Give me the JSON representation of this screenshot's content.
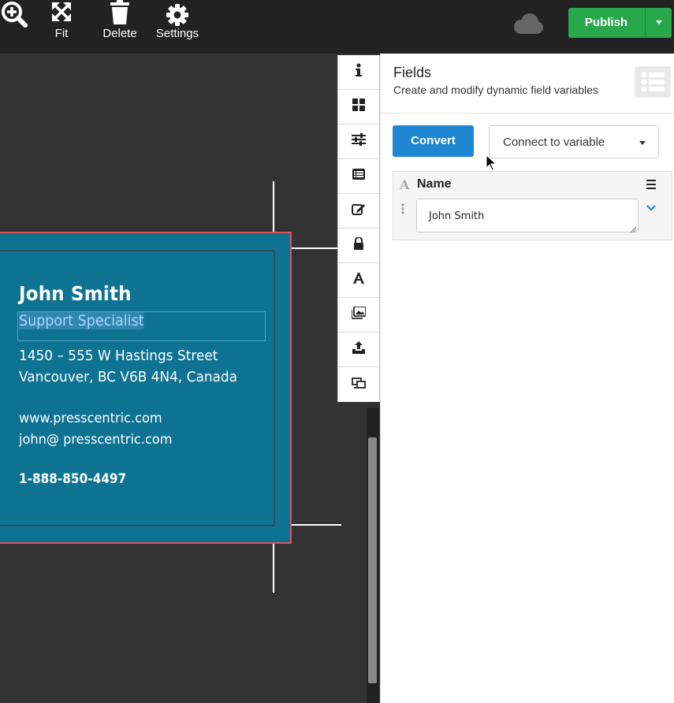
{
  "toolbar": {
    "zoom_icon": "zoom-in-icon",
    "fit_label": "Fit",
    "delete_label": "Delete",
    "settings_label": "Settings",
    "publish_label": "Publish"
  },
  "card": {
    "name": "John Smith",
    "title": "Support Specialist",
    "address_line1": "1450 – 555 W Hastings Street",
    "address_line2": "Vancouver, BC V6B 4N4, Canada",
    "website": "www.presscentric.com",
    "email": "john@ presscentric.com",
    "phone": "1-888-850-4497",
    "colors": {
      "background": "#0e7393",
      "bleed": "#e0525c",
      "safe": "#2c4e57"
    }
  },
  "strip": {
    "icons": [
      "info-icon",
      "grid-icon",
      "sliders-icon",
      "list-icon",
      "edit-icon",
      "lock-icon",
      "font-icon",
      "images-icon",
      "upload-icon",
      "preview-icon"
    ]
  },
  "panel": {
    "title": "Fields",
    "subtitle": "Create and modify dynamic field variables",
    "convert_label": "Convert",
    "connect_label": "Connect to variable",
    "field": {
      "type_glyph": "A",
      "name": "Name",
      "value": "John Smith"
    }
  },
  "colors": {
    "publish": "#27a84a",
    "convert": "#1f86d1",
    "topbar": "#222222",
    "canvas": "#333333"
  }
}
